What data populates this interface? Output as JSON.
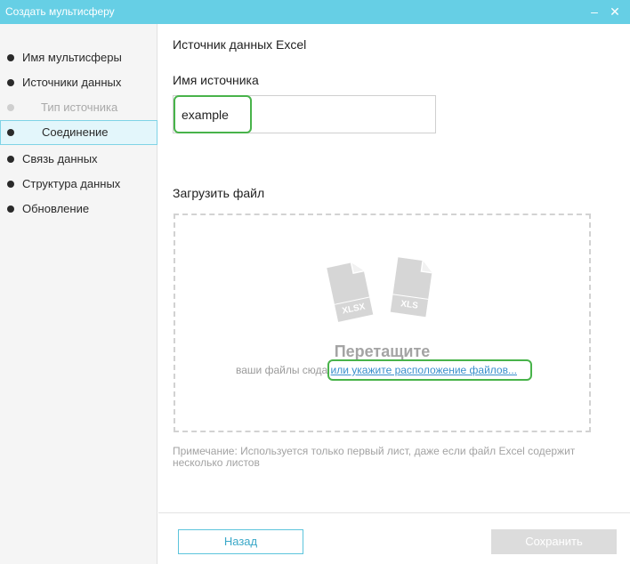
{
  "window": {
    "title": "Создать мультисферу",
    "minimize_icon": "minimize-icon",
    "close_icon": "close-icon"
  },
  "sidebar": {
    "steps": [
      {
        "label": "Имя мультисферы",
        "state": "done"
      },
      {
        "label": "Источники данных",
        "state": "done"
      },
      {
        "label": "Тип источника",
        "state": "substep-inactive"
      },
      {
        "label": "Соединение",
        "state": "active"
      },
      {
        "label": "Связь данных",
        "state": "pending"
      },
      {
        "label": "Структура данных",
        "state": "pending"
      },
      {
        "label": "Обновление",
        "state": "pending"
      }
    ]
  },
  "main": {
    "heading": "Источник данных Excel",
    "source_name_label": "Имя источника",
    "source_name_value": "example",
    "upload_label": "Загрузить файл",
    "dropzone": {
      "icons": [
        "XLSX",
        "XLS"
      ],
      "drag_title": "Перетащите",
      "drag_text": "ваши файлы сюда",
      "browse_link": "или укажите расположение файлов..."
    },
    "note": "Примечание: Используется только первый лист, даже если файл Excel содержит несколько листов"
  },
  "footer": {
    "back_label": "Назад",
    "save_label": "Сохранить",
    "save_enabled": false
  },
  "colors": {
    "titlebar": "#66cfe5",
    "accent": "#3aa8c8",
    "highlight": "#48b34a",
    "active_step_bg": "#e3f6fb"
  }
}
